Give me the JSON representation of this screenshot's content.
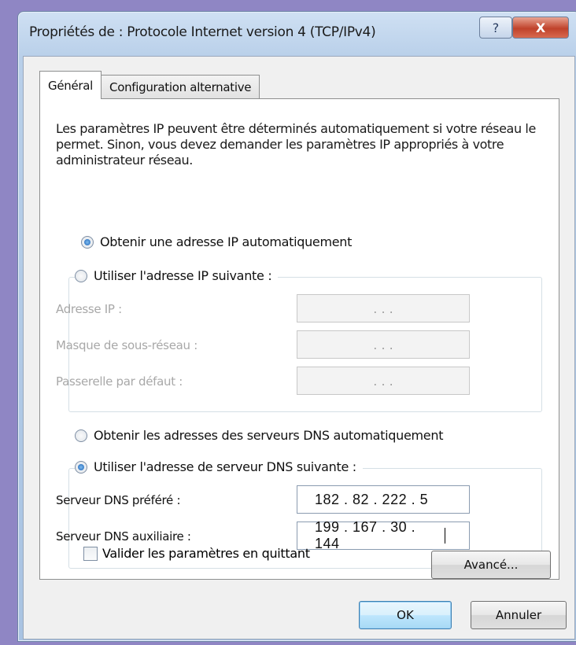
{
  "window": {
    "title": "Propriétés de : Protocole Internet version 4 (TCP/IPv4)",
    "help_label": "?",
    "close_label": "X"
  },
  "tabs": [
    {
      "label": "Général",
      "active": true
    },
    {
      "label": "Configuration alternative",
      "active": false
    }
  ],
  "intro_text": "Les paramètres IP peuvent être déterminés automatiquement si votre réseau le permet. Sinon, vous devez demander les paramètres IP appropriés à votre administrateur réseau.",
  "ip_section": {
    "auto_label": "Obtenir une adresse IP automatiquement",
    "auto_selected": true,
    "manual_label": "Utiliser l'adresse IP suivante :",
    "manual_selected": false,
    "fields": [
      {
        "label": "Adresse IP :",
        "value": ".   .   ."
      },
      {
        "label": "Masque de sous-réseau :",
        "value": ".   .   ."
      },
      {
        "label": "Passerelle par défaut :",
        "value": ".   .   ."
      }
    ]
  },
  "dns_section": {
    "auto_label": "Obtenir les adresses des serveurs DNS automatiquement",
    "auto_selected": false,
    "manual_label": "Utiliser l'adresse de serveur DNS suivante :",
    "manual_selected": true,
    "preferred_label": "Serveur DNS préféré :",
    "preferred_value": "182 . 82 . 222 . 5",
    "alternate_label": "Serveur DNS auxiliaire :",
    "alternate_value": "199 . 167 . 30 . 144"
  },
  "validate_checkbox": {
    "label": "Valider les paramètres en quittant",
    "checked": false
  },
  "buttons": {
    "advanced": "Avancé...",
    "ok": "OK",
    "cancel": "Annuler"
  }
}
